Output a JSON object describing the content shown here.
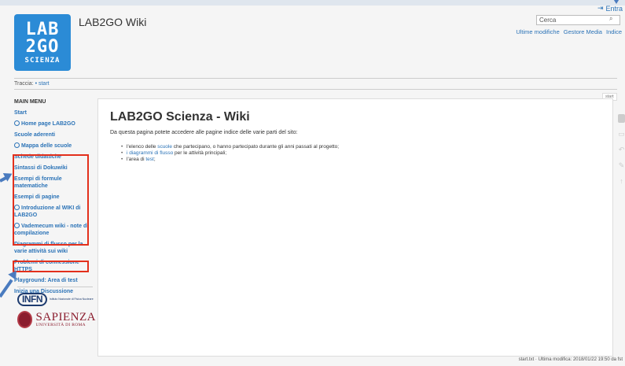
{
  "logo": {
    "line1": "LAB",
    "line2": "2GO",
    "line3": "SCIENZA"
  },
  "header": {
    "site_title": "LAB2GO Wiki",
    "login_label": "Entra",
    "search_placeholder": "Cerca",
    "user_tools": [
      "Ultime modifiche",
      "Gestore Media",
      "Indice"
    ]
  },
  "breadcrumb": {
    "label": "Traccia:",
    "item": "• start"
  },
  "sidebar": {
    "title": "MAIN MENU",
    "items": [
      {
        "label": "Start",
        "globe": false
      },
      {
        "label": "Home page LAB2GO",
        "globe": true
      },
      {
        "label": "Scuole aderenti",
        "globe": false
      },
      {
        "label": "Mappa delle scuole",
        "globe": true
      },
      {
        "label": "Schede didattiche",
        "globe": false
      },
      {
        "label": "Sintassi di Dokuwiki",
        "globe": false
      },
      {
        "label": "Esempi di formule matematiche",
        "globe": false
      },
      {
        "label": "Esempi di pagine",
        "globe": false
      },
      {
        "label": "Introduzione al WIKI di LAB2GO",
        "globe": true
      },
      {
        "label": "Vademecum wiki - note di compilazione",
        "globe": true
      },
      {
        "label": "Diagrammi di flusso per la varie attività sui wiki",
        "globe": false
      },
      {
        "label": "Problemi di connessione HTTPS",
        "globe": false
      },
      {
        "label": "Playground: Area di test",
        "globe": false
      },
      {
        "label": "Inizia una Discussione",
        "globe": false
      }
    ],
    "logos": {
      "infn_mark": "INFN",
      "infn_text": "Istituto Nazionale di Fisica Nucleare",
      "sapienza_name": "SAPIENZA",
      "sapienza_sub": "UNIVERSITÀ DI ROMA"
    }
  },
  "page": {
    "tab": "start",
    "title": "LAB2GO Scienza - Wiki",
    "intro": "Da questa pagina potete accedere alle pagine indice delle varie parti del sito:",
    "list": [
      {
        "before": "l'elenco delle ",
        "link": "scuole",
        "after": " che partecipano, o hanno partecipato durante gli anni passati al progetto;"
      },
      {
        "before": "",
        "link": "i diagrammi di flusso",
        "after": " per le attività principali;"
      },
      {
        "before": "l'area di ",
        "link": "test",
        "after": ";"
      }
    ]
  },
  "footer": {
    "text": "start.txt · Ultima modifica: 2018/01/22 19:50 da fst"
  },
  "colors": {
    "link": "#2b73b7",
    "highlight": "#e3301c",
    "annotation_arrow": "#4a7bbf",
    "logo_bg": "#2b8bd6"
  },
  "icons": [
    "login-icon",
    "search-icon",
    "globe-icon",
    "edit-icon",
    "revisions-icon",
    "backlinks-icon",
    "subscribe-icon",
    "back-to-top-icon"
  ]
}
